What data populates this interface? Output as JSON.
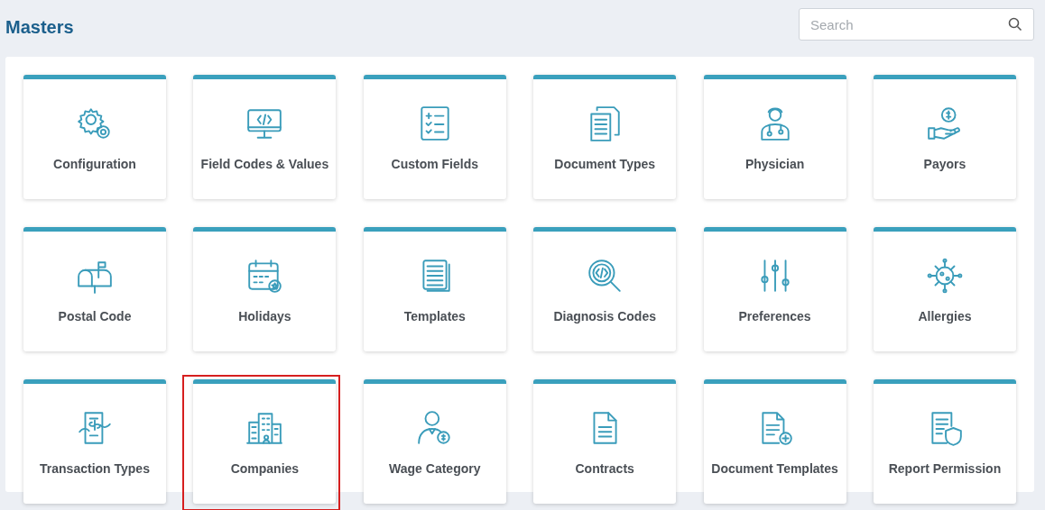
{
  "page": {
    "title": "Masters"
  },
  "search": {
    "placeholder": "Search"
  },
  "tiles": [
    {
      "label": "Configuration",
      "highlighted": false
    },
    {
      "label": "Field Codes & Values",
      "highlighted": false
    },
    {
      "label": "Custom Fields",
      "highlighted": false
    },
    {
      "label": "Document Types",
      "highlighted": false
    },
    {
      "label": "Physician",
      "highlighted": false
    },
    {
      "label": "Payors",
      "highlighted": false
    },
    {
      "label": "Postal Code",
      "highlighted": false
    },
    {
      "label": "Holidays",
      "highlighted": false
    },
    {
      "label": "Templates",
      "highlighted": false
    },
    {
      "label": "Diagnosis Codes",
      "highlighted": false
    },
    {
      "label": "Preferences",
      "highlighted": false
    },
    {
      "label": "Allergies",
      "highlighted": false
    },
    {
      "label": "Transaction Types",
      "highlighted": false
    },
    {
      "label": "Companies",
      "highlighted": true
    },
    {
      "label": "Wage Category",
      "highlighted": false
    },
    {
      "label": "Contracts",
      "highlighted": false
    },
    {
      "label": "Document Templates",
      "highlighted": false
    },
    {
      "label": "Report Permission",
      "highlighted": false
    }
  ]
}
